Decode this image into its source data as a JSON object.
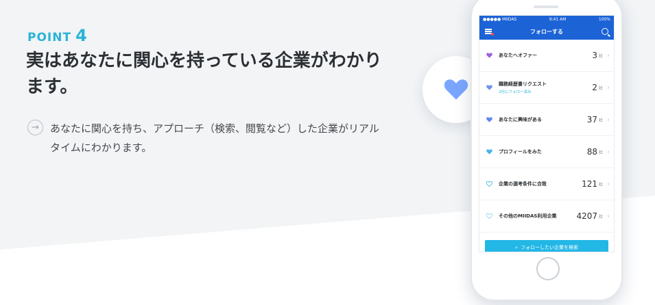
{
  "point": {
    "label": "POINT",
    "number": "4"
  },
  "headline": "実はあなたに関心を持っている企業がわかります。",
  "description": "あなたに関心を持ち、アプローチ（検索、閲覧など）した企業がリアルタイムにわかります。",
  "colors": {
    "accent": "#2ab3d6",
    "brand_blue": "#1c63d6",
    "heart": "#7aa6ff",
    "cta": "#23b7e6"
  },
  "phone": {
    "status_left": "●●●●● MIIDAS",
    "status_time": "9:41 AM",
    "status_right": "100%",
    "nav_title": "フォローする",
    "rows": [
      {
        "label": "あなたへオファー",
        "sub": "",
        "count": "3",
        "unit": "社",
        "icon": "heart-filled-purple"
      },
      {
        "label": "職務経歴書リクエスト",
        "sub": "2社にフォロー済み",
        "count": "2",
        "unit": "社",
        "icon": "heart-outline"
      },
      {
        "label": "あなたに興味がある",
        "sub": "",
        "count": "37",
        "unit": "社",
        "icon": "heart-filled-blue"
      },
      {
        "label": "プロフィールをみた",
        "sub": "",
        "count": "88",
        "unit": "社",
        "icon": "heart-filled-lightblue"
      },
      {
        "label": "企業の選考条件に合致",
        "sub": "",
        "count": "121",
        "unit": "社",
        "icon": "heart-outline"
      },
      {
        "label": "その他のMIIDAS利用企業",
        "sub": "",
        "count": "4207",
        "unit": "社",
        "icon": "heart-outline-light"
      }
    ],
    "cta_label": "フォローしたい企業を検索"
  }
}
